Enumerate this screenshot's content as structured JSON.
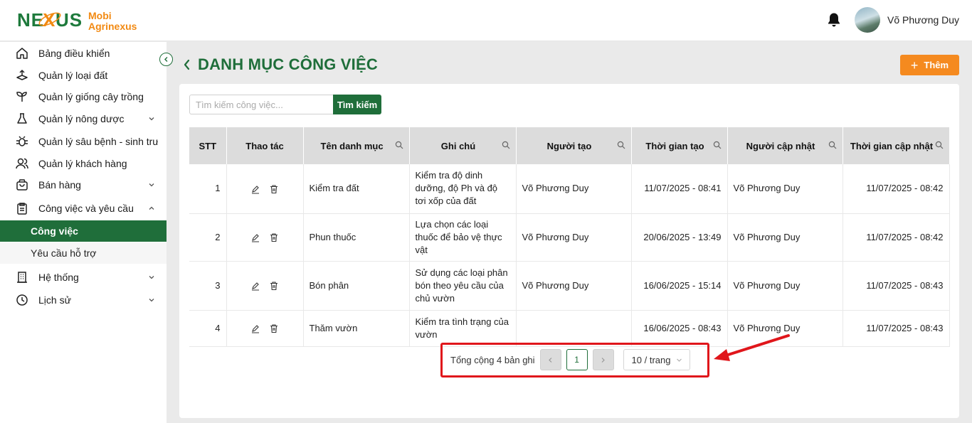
{
  "header": {
    "logo_mark": "NEXUS",
    "logo_line1": "Mobi",
    "logo_line2": "Agrinexus",
    "user_name": "Võ Phương Duy"
  },
  "sidebar": {
    "items": [
      {
        "label": "Bảng điều khiển",
        "icon": "home-icon"
      },
      {
        "label": "Quản lý loại đất",
        "icon": "soil-icon"
      },
      {
        "label": "Quản lý giống cây trồng",
        "icon": "plant-icon"
      },
      {
        "label": "Quản lý nông dược",
        "icon": "flask-icon"
      },
      {
        "label": "Quản lý sâu bệnh - sinh trưởng",
        "icon": "bug-icon"
      },
      {
        "label": "Quản lý khách hàng",
        "icon": "users-icon"
      },
      {
        "label": "Bán hàng",
        "icon": "bag-icon"
      },
      {
        "label": "Công việc và yêu cầu",
        "icon": "clipboard-icon"
      },
      {
        "label": "Hệ thống",
        "icon": "building-icon"
      },
      {
        "label": "Lịch sử",
        "icon": "clock-icon"
      }
    ],
    "sub_items": [
      {
        "label": "Công việc",
        "active": true
      },
      {
        "label": "Yêu cầu hỗ trợ",
        "active": false
      }
    ]
  },
  "page": {
    "title": "DANH MỤC CÔNG VIỆC",
    "add_label": "Thêm",
    "search_placeholder": "Tìm kiếm công việc...",
    "search_button": "Tìm kiếm"
  },
  "table": {
    "columns": [
      "STT",
      "Thao tác",
      "Tên danh mục",
      "Ghi chú",
      "Người tạo",
      "Thời gian tạo",
      "Người cập nhật",
      "Thời gian cập nhật"
    ],
    "rows": [
      {
        "stt": "1",
        "name": "Kiểm tra đất",
        "note": "Kiểm tra độ dinh dưỡng, độ Ph và độ tơi xốp của đất",
        "creator": "Võ Phương Duy",
        "created": "11/07/2025 - 08:41",
        "updater": "Võ Phương Duy",
        "updated": "11/07/2025 - 08:42"
      },
      {
        "stt": "2",
        "name": "Phun thuốc",
        "note": "Lựa chọn các loại thuốc để bảo vệ thực vật",
        "creator": "Võ Phương Duy",
        "created": "20/06/2025 - 13:49",
        "updater": "Võ Phương Duy",
        "updated": "11/07/2025 - 08:42"
      },
      {
        "stt": "3",
        "name": "Bón phân",
        "note": "Sử dụng các loại phân bón theo yêu cầu của chủ vườn",
        "creator": "Võ Phương Duy",
        "created": "16/06/2025 - 15:14",
        "updater": "Võ Phương Duy",
        "updated": "11/07/2025 - 08:43"
      },
      {
        "stt": "4",
        "name": "Thăm vườn",
        "note": "Kiểm tra tình trạng của vườn",
        "creator": "",
        "created": "16/06/2025 - 08:43",
        "updater": "Võ Phương Duy",
        "updated": "11/07/2025 - 08:43"
      }
    ]
  },
  "pagination": {
    "total_text": "Tổng cộng 4 bản ghi",
    "current_page": "1",
    "page_size": "10 / trang"
  },
  "colors": {
    "brand_green": "#1f6e3a",
    "accent_orange": "#f58a1f",
    "highlight_red": "#e0161b"
  }
}
